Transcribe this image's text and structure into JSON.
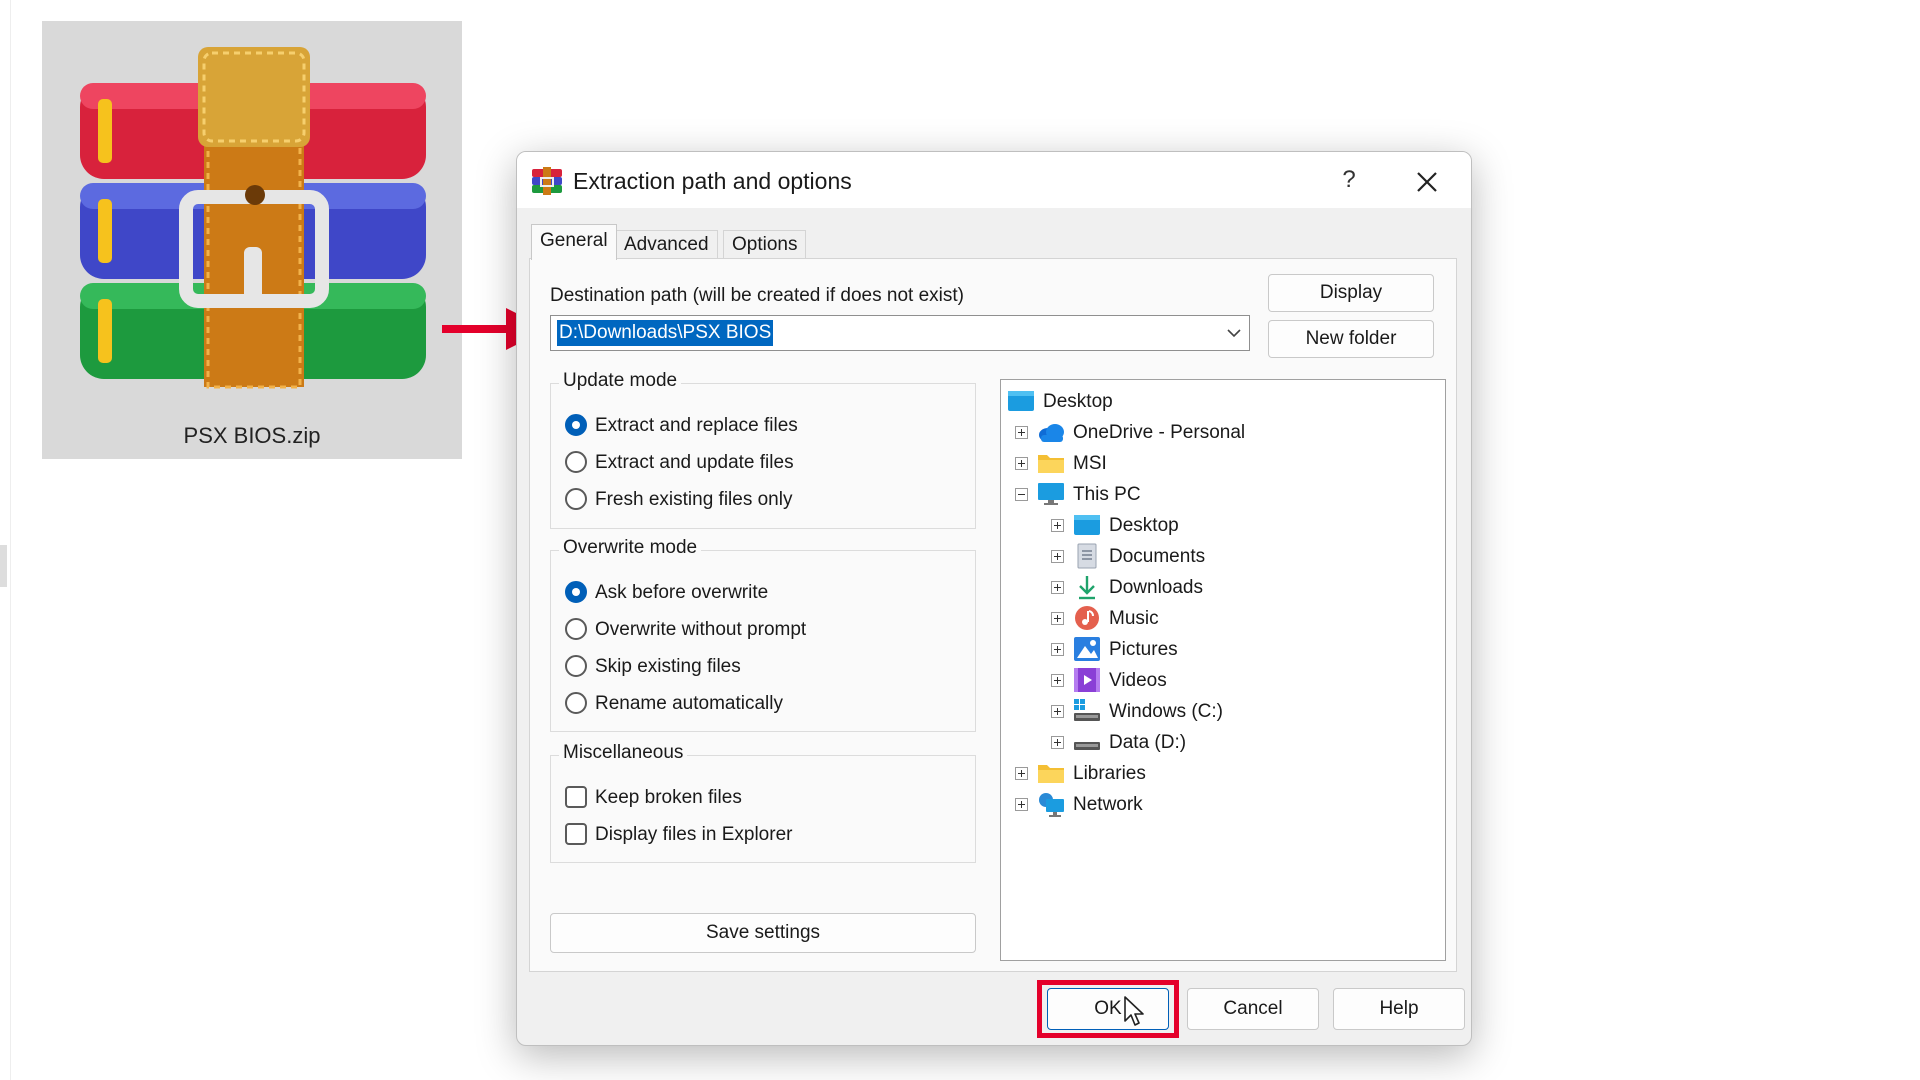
{
  "file": {
    "name": "PSX BIOS.zip",
    "icon": "winrar-archive-icon"
  },
  "dialog": {
    "title": "Extraction path and options",
    "help_glyph": "?",
    "tabs": [
      {
        "label": "General",
        "active": true
      },
      {
        "label": "Advanced",
        "active": false
      },
      {
        "label": "Options",
        "active": false
      }
    ],
    "destination_label": "Destination path (will be created if does not exist)",
    "destination_value": "D:\\Downloads\\PSX BIOS",
    "display_button": "Display",
    "new_folder_button": "New folder",
    "update_mode": {
      "title": "Update mode",
      "options": [
        {
          "label": "Extract and replace files",
          "selected": true
        },
        {
          "label": "Extract and update files",
          "selected": false
        },
        {
          "label": "Fresh existing files only",
          "selected": false
        }
      ]
    },
    "overwrite_mode": {
      "title": "Overwrite mode",
      "options": [
        {
          "label": "Ask before overwrite",
          "selected": true
        },
        {
          "label": "Overwrite without prompt",
          "selected": false
        },
        {
          "label": "Skip existing files",
          "selected": false
        },
        {
          "label": "Rename automatically",
          "selected": false
        }
      ]
    },
    "miscellaneous": {
      "title": "Miscellaneous",
      "options": [
        {
          "label": "Keep broken files",
          "checked": false
        },
        {
          "label": "Display files in Explorer",
          "checked": false
        }
      ]
    },
    "save_settings_button": "Save settings",
    "tree": [
      {
        "label": "Desktop",
        "icon": "desktop-icon",
        "level": 0,
        "expander": "none"
      },
      {
        "label": "OneDrive - Personal",
        "icon": "cloud-icon",
        "level": 1,
        "expander": "plus"
      },
      {
        "label": "MSI",
        "icon": "folder-icon",
        "level": 1,
        "expander": "plus"
      },
      {
        "label": "This PC",
        "icon": "monitor-icon",
        "level": 1,
        "expander": "minus"
      },
      {
        "label": "Desktop",
        "icon": "desktop-icon",
        "level": 2,
        "expander": "plus"
      },
      {
        "label": "Documents",
        "icon": "document-icon",
        "level": 2,
        "expander": "plus"
      },
      {
        "label": "Downloads",
        "icon": "download-arrow-icon",
        "level": 2,
        "expander": "plus"
      },
      {
        "label": "Music",
        "icon": "music-icon",
        "level": 2,
        "expander": "plus"
      },
      {
        "label": "Pictures",
        "icon": "pictures-icon",
        "level": 2,
        "expander": "plus"
      },
      {
        "label": "Videos",
        "icon": "videos-icon",
        "level": 2,
        "expander": "plus"
      },
      {
        "label": "Windows (C:)",
        "icon": "windows-drive-icon",
        "level": 2,
        "expander": "plus"
      },
      {
        "label": "Data (D:)",
        "icon": "drive-icon",
        "level": 2,
        "expander": "plus"
      },
      {
        "label": "Libraries",
        "icon": "folder-icon",
        "level": 1,
        "expander": "plus"
      },
      {
        "label": "Network",
        "icon": "network-icon",
        "level": 1,
        "expander": "plus"
      }
    ],
    "ok_button": "OK",
    "cancel_button": "Cancel",
    "help_button": "Help"
  },
  "colors": {
    "accent": "#005fb8",
    "selection": "#0067c0",
    "annotation_red": "#e4002b"
  }
}
